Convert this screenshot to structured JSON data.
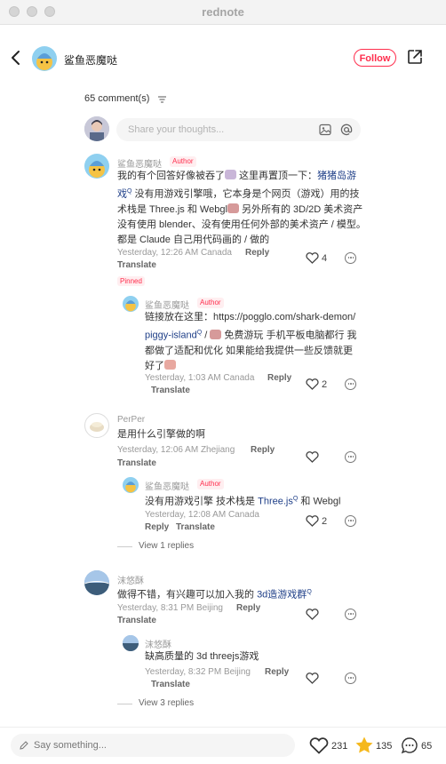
{
  "window": {
    "title": "rednote"
  },
  "header": {
    "author": "鲨鱼恶魔哒",
    "follow_label": "Follow"
  },
  "comments_header": {
    "count_label": "65 comment(s)"
  },
  "share_input": {
    "placeholder": "Share your thoughts..."
  },
  "badges": {
    "author": "Author",
    "pinned": "Pinned"
  },
  "actions": {
    "reply": "Reply",
    "translate": "Translate"
  },
  "comments": [
    {
      "user": "鲨鱼恶魔哒",
      "text_a": "我的有个回答好像被吞了",
      "text_b": " 这里再置顶一下：",
      "link": "猪猪岛游戏",
      "text_c": " 没有用游戏引擎哦，它本身是个网页（游戏）用的技术栈是 Three.js 和 Webgl",
      "text_d": " 另外所有的 3D/2D 美术资产没有使用 blender、没有使用任何外部的美术资产 / 模型。都是 Claude 自己用代码画的 / 做的",
      "meta": "Yesterday, 12:26 AM Canada",
      "likes": "4"
    },
    {
      "user": "鲨鱼恶魔哒",
      "text_a": "链接放在这里：https://pogglo.com/shark-demon/ ",
      "link": "piggy-island",
      "text_b": " / ",
      "text_c": " 免费游玩 手机平板电脑都行 我都做了适配和优化 如果能给我提供一些反馈就更好了",
      "meta": "Yesterday, 1:03 AM Canada",
      "likes": "2"
    },
    {
      "user": "PerPer",
      "text": "是用什么引擎做的啊",
      "meta": "Yesterday, 12:06 AM Zhejiang"
    },
    {
      "user": "鲨鱼恶魔哒",
      "text_a": "没有用游戏引擎 技术栈是 ",
      "link": "Three.js",
      "text_b": " 和 Webgl",
      "meta": "Yesterday, 12:08 AM Canada",
      "likes": "2",
      "view_replies": "View 1 replies"
    },
    {
      "user": "沫悠酥",
      "text_a": "做得不错，有兴趣可以加入我的 ",
      "link": "3d造游戏群",
      "meta": "Yesterday, 8:31 PM Beijing"
    },
    {
      "user": "沫悠酥",
      "text": "缺高质量的 3d threejs游戏",
      "meta": "Yesterday, 8:32 PM Beijing",
      "view_replies": "View 3 replies"
    }
  ],
  "bottom": {
    "placeholder": "Say something...",
    "likes": "231",
    "stars": "135",
    "comments": "65"
  },
  "colors": {
    "brand": "#ff2e4d",
    "link": "#1f3f88",
    "star": "#f5b81c"
  }
}
